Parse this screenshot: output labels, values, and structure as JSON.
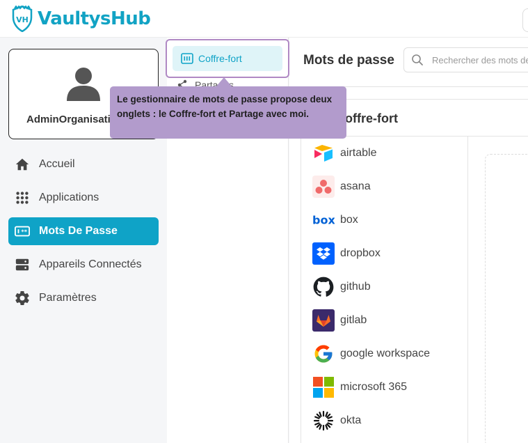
{
  "app": {
    "brand": "VaultysHub",
    "logo_mark": "VH"
  },
  "profile": {
    "name": "AdminOrganisation",
    "avatar_icon": "user-icon"
  },
  "nav": {
    "items": [
      {
        "label": "Accueil",
        "icon": "home-icon"
      },
      {
        "label": "Applications",
        "icon": "grid-icon"
      },
      {
        "label": "Mots De Passe",
        "icon": "password-icon",
        "active": true
      },
      {
        "label": "Appareils Connectés",
        "icon": "server-icon"
      },
      {
        "label": "Paramètres",
        "icon": "gear-icon"
      }
    ]
  },
  "tabs": {
    "vault": {
      "label": "Coffre-fort",
      "icon": "vault-icon"
    },
    "shared": {
      "label": "Partagés",
      "icon": "share-icon"
    }
  },
  "main": {
    "title": "Mots de passe",
    "search_placeholder": "Rechercher des mots de passe",
    "panel_title": "Coffre-fort"
  },
  "apps": [
    {
      "name": "airtable",
      "icon": "airtable-icon"
    },
    {
      "name": "asana",
      "icon": "asana-icon"
    },
    {
      "name": "box",
      "icon": "box-icon"
    },
    {
      "name": "dropbox",
      "icon": "dropbox-icon"
    },
    {
      "name": "github",
      "icon": "github-icon"
    },
    {
      "name": "gitlab",
      "icon": "gitlab-icon"
    },
    {
      "name": "google workspace",
      "icon": "google-icon"
    },
    {
      "name": "microsoft 365",
      "icon": "microsoft-icon"
    },
    {
      "name": "okta",
      "icon": "okta-icon"
    }
  ],
  "tooltip": {
    "text": "Le gestionnaire de mots de passe propose deux onglets : le Coffre-fort et Partage avec moi."
  },
  "colors": {
    "accent": "#0fa3c7",
    "tooltip_bg": "#b29bcc",
    "highlight_outline": "#b089c4"
  }
}
